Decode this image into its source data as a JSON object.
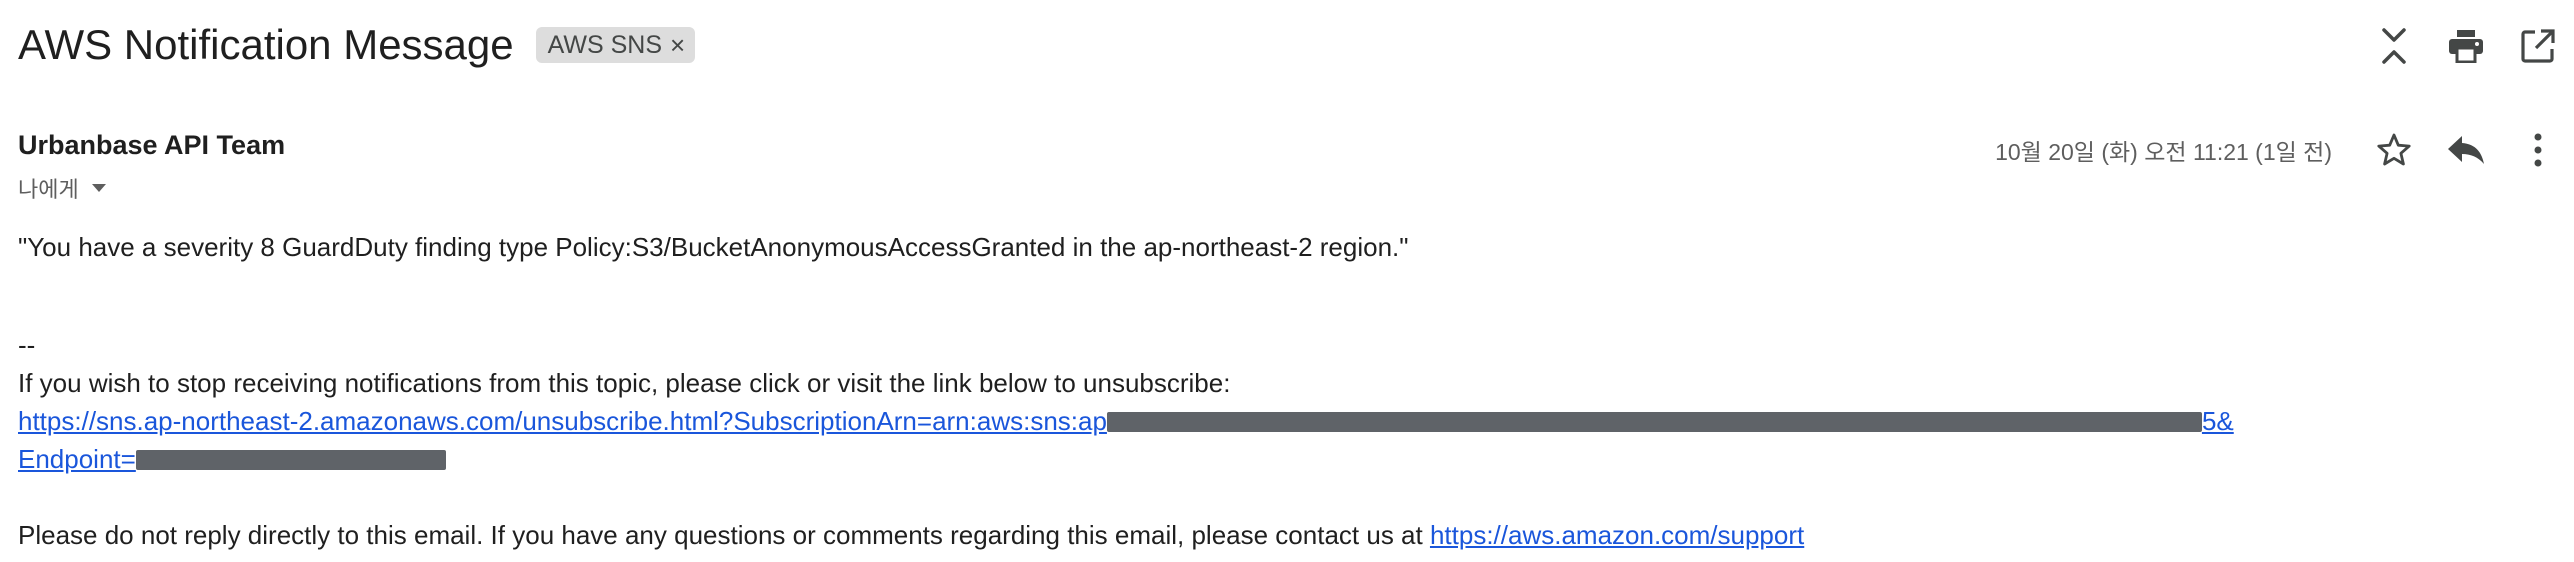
{
  "subject": "AWS Notification Message",
  "label_chip": {
    "text": "AWS SNS",
    "remove_symbol": "×"
  },
  "top_actions": [
    {
      "name": "expand-collapse-icon"
    },
    {
      "name": "print-icon"
    },
    {
      "name": "open-in-new-window-icon"
    }
  ],
  "sender": {
    "name": "Urbanbase API Team"
  },
  "recipient": {
    "label": "나에게"
  },
  "timestamp": "10월 20일 (화) 오전 11:21 (1일 전)",
  "message_actions": [
    {
      "name": "star-icon"
    },
    {
      "name": "reply-icon"
    },
    {
      "name": "more-options-icon"
    }
  ],
  "body": {
    "finding_line": "\"You have a severity 8 GuardDuty finding type Policy:S3/BucketAnonymousAccessGranted in the ap-northeast-2 region.\"",
    "signature_separator": "--",
    "unsubscribe_intro": "If you wish to stop receiving notifications from this topic, please click or visit the link below to unsubscribe:",
    "unsubscribe_link_start": "https://sns.ap-northeast-2.amazonaws.com/unsubscribe.html?SubscriptionArn=arn:aws:sns:ap",
    "unsubscribe_link_end": "5&",
    "endpoint_prefix": "Endpoint=",
    "footer_text": "Please do not reply directly to this email. If you have any questions or comments regarding this email, please contact us at ",
    "support_link": "https://aws.amazon.com/support"
  },
  "colors": {
    "text": "#1f1f1f",
    "secondary_text": "#5e5e5e",
    "link": "#1a56db",
    "chip_bg": "#dddddd",
    "redaction": "#5f6368"
  }
}
